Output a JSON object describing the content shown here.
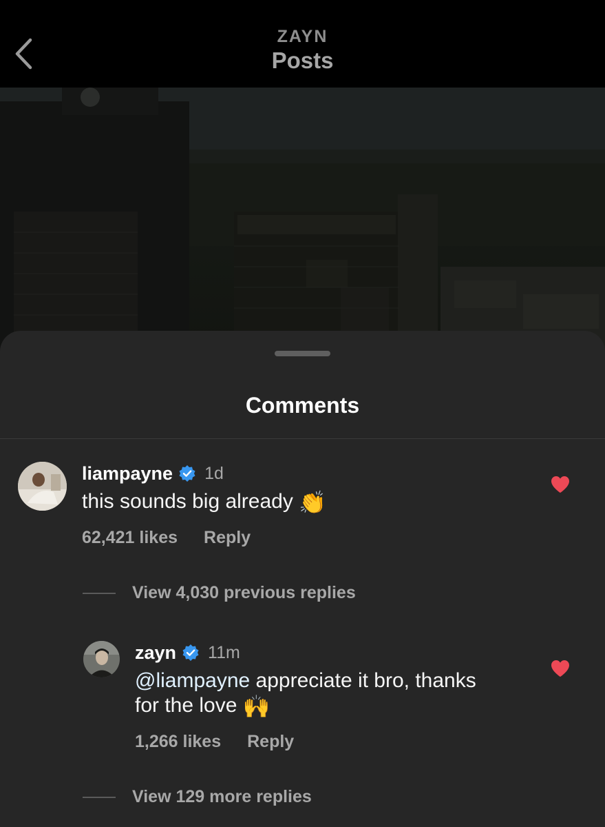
{
  "nav": {
    "account": "ZAYN",
    "title": "Posts",
    "back_icon": "chevron-left-icon"
  },
  "sheet": {
    "title": "Comments"
  },
  "comments": [
    {
      "username": "liampayne",
      "verified": true,
      "time": "1d",
      "text": "this sounds big already",
      "emoji": "👏",
      "likes": "62,421 likes",
      "reply_label": "Reply",
      "liked": true
    }
  ],
  "replies_toggle_previous": "View 4,030 previous replies",
  "replies": [
    {
      "username": "zayn",
      "verified": true,
      "time": "11m",
      "mention": "@liampayne",
      "text_line1": " appreciate it bro, thanks",
      "text_line2": "for the love",
      "emoji": "🙌",
      "likes": "1,266 likes",
      "reply_label": "Reply",
      "liked": true
    }
  ],
  "replies_toggle_more": "View 129 more replies",
  "colors": {
    "heart": "#ed4956",
    "verified": "#3897f0",
    "sheet_bg": "#262626"
  }
}
